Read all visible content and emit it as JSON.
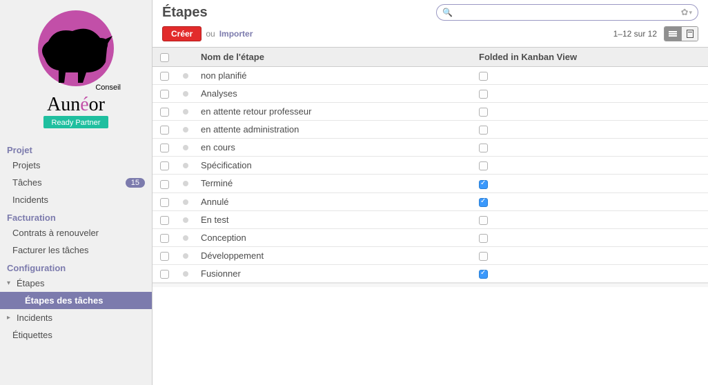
{
  "page_title": "Étapes",
  "search": {
    "placeholder": ""
  },
  "toolbar": {
    "create_label": "Créer",
    "or_label": "ou",
    "import_label": "Importer"
  },
  "pager": {
    "text": "1–12 sur 12"
  },
  "sidebar": {
    "sections": [
      {
        "title": "Projet",
        "items": [
          {
            "label": "Projets"
          },
          {
            "label": "Tâches",
            "badge": "15"
          },
          {
            "label": "Incidents"
          }
        ]
      },
      {
        "title": "Facturation",
        "items": [
          {
            "label": "Contrats à renouveler"
          },
          {
            "label": "Facturer les tâches"
          }
        ]
      },
      {
        "title": "Configuration",
        "items": [
          {
            "label": "Étapes",
            "expanded": true,
            "children": [
              {
                "label": "Étapes des tâches",
                "active": true
              }
            ]
          },
          {
            "label": "Incidents",
            "expandable": true
          },
          {
            "label": "Étiquettes"
          }
        ]
      }
    ]
  },
  "logo": {
    "brand_top": "Conseil",
    "brand_main": "Aunéor",
    "badge": "Ready Partner"
  },
  "table": {
    "columns": {
      "name": "Nom de l'étape",
      "folded": "Folded in Kanban View"
    },
    "rows": [
      {
        "name": "non planifié",
        "folded": false
      },
      {
        "name": "Analyses",
        "folded": false
      },
      {
        "name": "en attente retour professeur",
        "folded": false
      },
      {
        "name": "en attente administration",
        "folded": false
      },
      {
        "name": "en cours",
        "folded": false
      },
      {
        "name": "Spécification",
        "folded": false
      },
      {
        "name": "Terminé",
        "folded": true
      },
      {
        "name": "Annulé",
        "folded": true
      },
      {
        "name": "En test",
        "folded": false
      },
      {
        "name": "Conception",
        "folded": false
      },
      {
        "name": "Développement",
        "folded": false
      },
      {
        "name": "Fusionner",
        "folded": true
      }
    ]
  }
}
